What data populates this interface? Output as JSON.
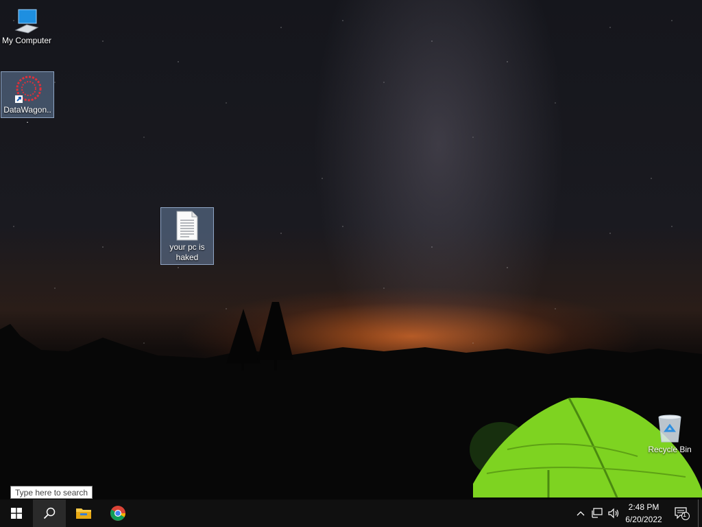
{
  "desktop": {
    "icons": [
      {
        "label": "My Computer",
        "icon": "computer-icon"
      },
      {
        "label": "DataWagon...",
        "icon": "datawagon-shortcut-icon"
      },
      {
        "label": "your pc is haked",
        "icon": "text-file-icon"
      },
      {
        "label": "Recycle Bin",
        "icon": "recycle-bin-icon"
      }
    ]
  },
  "taskbar": {
    "search_placeholder": "Type here to search",
    "pinned": [
      "start-icon",
      "search-icon",
      "file-explorer-icon",
      "chrome-icon"
    ],
    "tray": {
      "time": "2:48 PM",
      "date": "6/20/2022",
      "notification_count": "1"
    }
  },
  "colors": {
    "taskbar": "#101010",
    "tent": "#7ed321",
    "accent_windows": "#ffffff"
  }
}
